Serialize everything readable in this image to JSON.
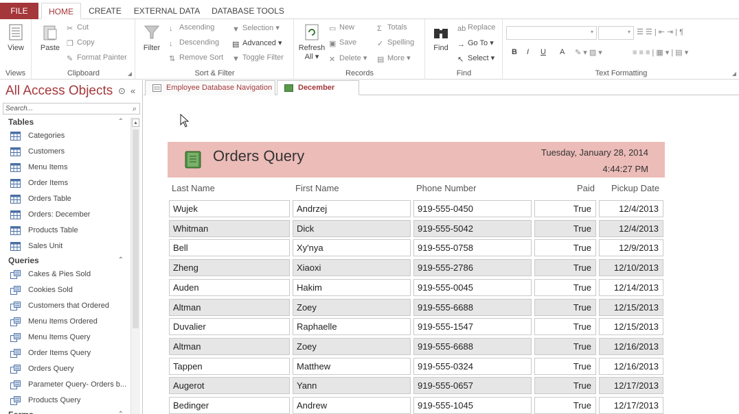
{
  "ribbon_tabs": [
    "FILE",
    "HOME",
    "CREATE",
    "EXTERNAL DATA",
    "DATABASE TOOLS"
  ],
  "ribbon": {
    "views": {
      "view_label": "View",
      "group": "Views"
    },
    "clipboard": {
      "paste": "Paste",
      "cut": "Cut",
      "copy": "Copy",
      "format_painter": "Format Painter",
      "group": "Clipboard"
    },
    "sort_filter": {
      "filter": "Filter",
      "ascending": "Ascending",
      "descending": "Descending",
      "remove_sort": "Remove Sort",
      "selection": "Selection",
      "advanced": "Advanced",
      "toggle_filter": "Toggle Filter",
      "group": "Sort & Filter"
    },
    "records": {
      "refresh": "Refresh",
      "refresh_all": "All",
      "new": "New",
      "save": "Save",
      "delete": "Delete",
      "totals": "Totals",
      "spelling": "Spelling",
      "more": "More",
      "group": "Records"
    },
    "find": {
      "find": "Find",
      "replace": "Replace",
      "goto": "Go To",
      "select": "Select",
      "group": "Find"
    },
    "text_formatting": {
      "bold": "B",
      "italic": "I",
      "underline": "U",
      "font_color": "A",
      "group": "Text Formatting"
    }
  },
  "nav": {
    "title": "All Access Objects",
    "search_placeholder": "Search...",
    "sections": [
      {
        "name": "Tables",
        "items": [
          "Categories",
          "Customers",
          "Menu Items",
          "Order Items",
          "Orders Table",
          "Orders: December",
          "Products Table",
          "Sales Unit"
        ]
      },
      {
        "name": "Queries",
        "items": [
          "Cakes & Pies Sold",
          "Cookies Sold",
          "Customers that Ordered",
          "Menu Items Ordered",
          "Menu Items Query",
          "Order Items Query",
          "Orders Query",
          "Parameter Query- Orders b...",
          "Products Query"
        ]
      },
      {
        "name": "Forms",
        "items": []
      }
    ]
  },
  "doc_tabs": [
    "Employee Database Navigation",
    "December Orders"
  ],
  "report": {
    "title": "Orders Query",
    "date": "Tuesday, January 28, 2014",
    "time": "4:44:27 PM",
    "columns": [
      "Last Name",
      "First Name",
      "Phone Number",
      "Paid",
      "Pickup Date"
    ],
    "rows": [
      [
        "Wujek",
        "Andrzej",
        "919-555-0450",
        "True",
        "12/4/2013"
      ],
      [
        "Whitman",
        "Dick",
        "919-555-5042",
        "True",
        "12/4/2013"
      ],
      [
        "Bell",
        "Xy'nya",
        "919-555-0758",
        "True",
        "12/9/2013"
      ],
      [
        "Zheng",
        "Xiaoxi",
        "919-555-2786",
        "True",
        "12/10/2013"
      ],
      [
        "Auden",
        "Hakim",
        "919-555-0045",
        "True",
        "12/14/2013"
      ],
      [
        "Altman",
        "Zoey",
        "919-555-6688",
        "True",
        "12/15/2013"
      ],
      [
        "Duvalier",
        "Raphaelle",
        "919-555-1547",
        "True",
        "12/15/2013"
      ],
      [
        "Altman",
        "Zoey",
        "919-555-6688",
        "True",
        "12/16/2013"
      ],
      [
        "Tappen",
        "Matthew",
        "919-555-0324",
        "True",
        "12/16/2013"
      ],
      [
        "Augerot",
        "Yann",
        "919-555-0657",
        "True",
        "12/17/2013"
      ],
      [
        "Bedinger",
        "Andrew",
        "919-555-1045",
        "True",
        "12/17/2013"
      ]
    ]
  },
  "colors": {
    "accent": "#a4373a",
    "header_band": "#ecbcb8",
    "alt_row": "#e6e6e6"
  }
}
